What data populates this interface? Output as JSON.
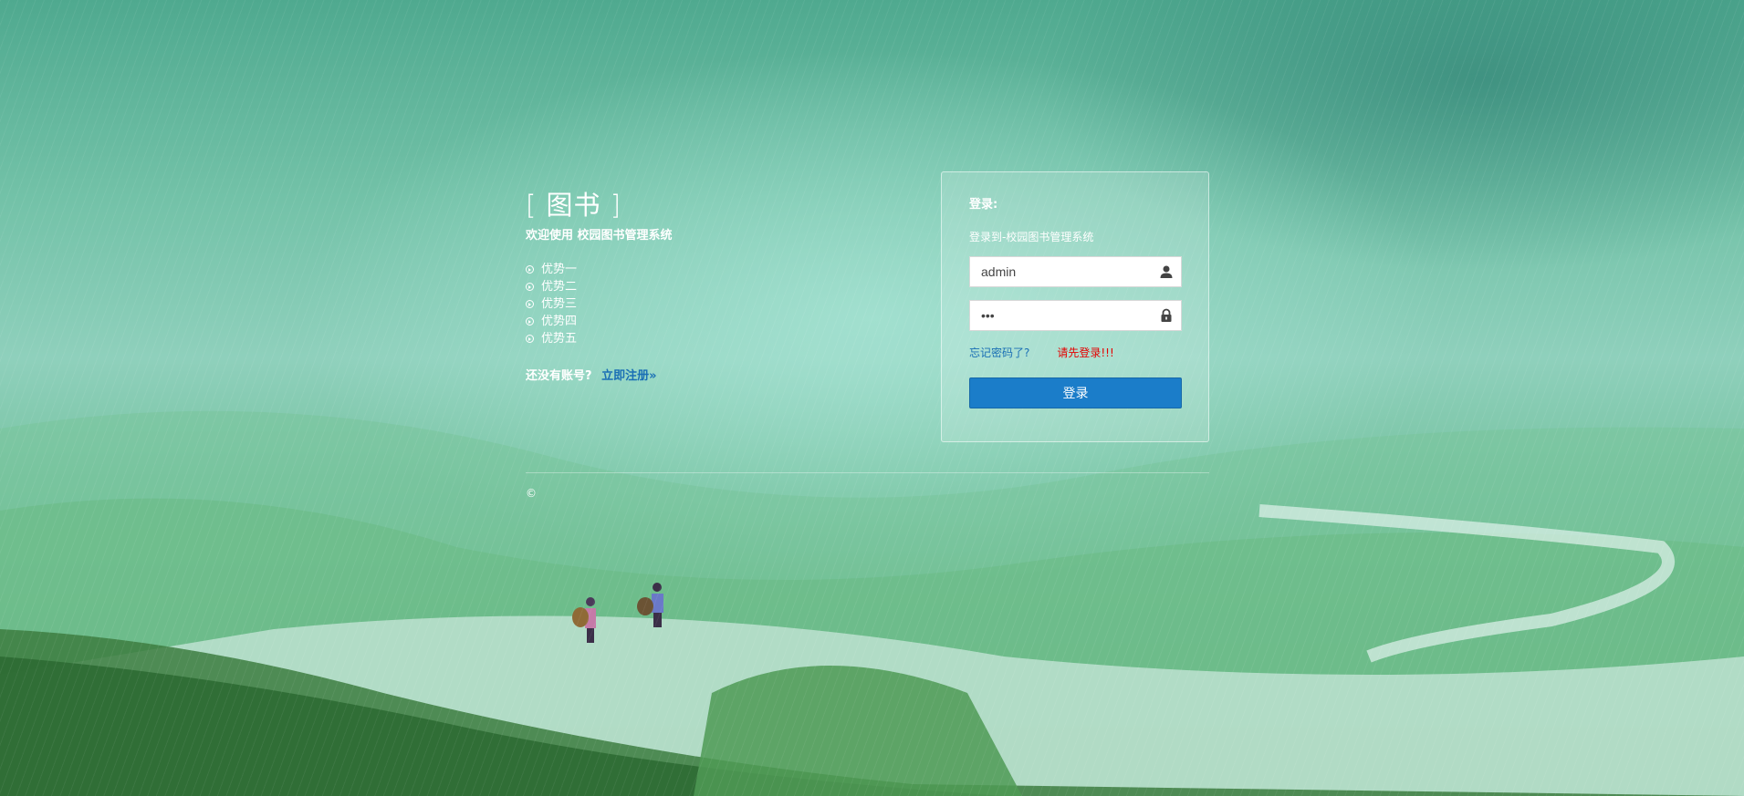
{
  "brand": {
    "title": "[ 图书 ]",
    "welcome": "欢迎使用 校园图书管理系统"
  },
  "features": [
    "优势一",
    "优势二",
    "优势三",
    "优势四",
    "优势五"
  ],
  "register": {
    "prompt": "还没有账号?",
    "link_label": "立即注册»"
  },
  "login": {
    "heading": "登录:",
    "subtitle": "登录到-校园图书管理系统",
    "username": {
      "value": "admin",
      "icon": "user-icon"
    },
    "password": {
      "value": "123",
      "icon": "lock-icon"
    },
    "forgot_label": "忘记密码了?",
    "error_message": "请先登录!!!",
    "submit_label": "登录"
  },
  "footer": {
    "copyright": "©"
  },
  "colors": {
    "link": "#1a6fb5",
    "error": "#e60000",
    "button": "#1b7dc9"
  }
}
